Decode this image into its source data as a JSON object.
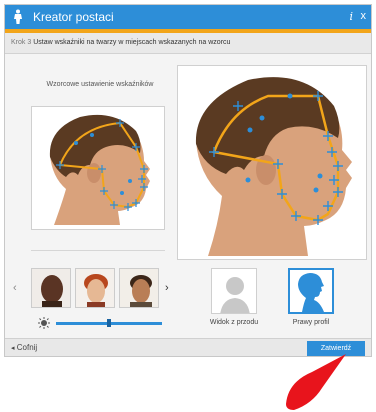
{
  "window": {
    "title": "Kreator postaci",
    "info_label": "i",
    "close_label": "x"
  },
  "step": {
    "number_label": "Krok 3",
    "instruction": "Ustaw wskaźniki na twarzy w miejscach wskazanych na wzorcu"
  },
  "left_panel": {
    "title": "Wzorcowe ustawienie wskaźników"
  },
  "views": {
    "front_label": "Widok z przodu",
    "profile_label": "Prawy profil"
  },
  "footer": {
    "back_label": "Cofnij",
    "confirm_label": "Zatwierdź"
  },
  "colors": {
    "accent": "#2d8ed8",
    "stripe": "#f2a51a",
    "pointer": "#e8141c"
  }
}
